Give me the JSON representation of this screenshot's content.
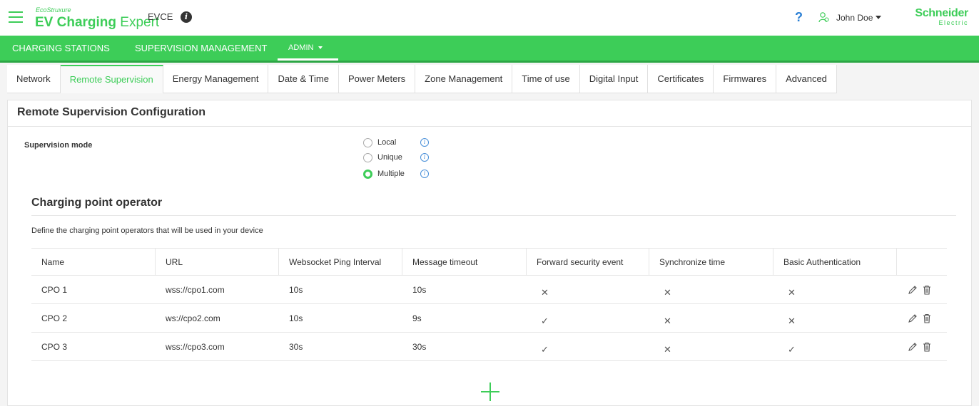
{
  "header": {
    "brand_small": "EcoStruxure",
    "brand_main_bold": "EV Charging",
    "brand_main_light": "Expert",
    "device": "EVCE",
    "info_glyph": "i",
    "help_glyph": "?",
    "user_name": "John Doe",
    "company_line1": "Schneider",
    "company_line2": "Electric",
    "accent_color": "#3dcd58"
  },
  "topnav": [
    {
      "label": "CHARGING STATIONS"
    },
    {
      "label": "SUPERVISION MANAGEMENT"
    },
    {
      "label": "ADMIN"
    }
  ],
  "tabs": [
    {
      "label": "Network"
    },
    {
      "label": "Remote Supervision",
      "active": true
    },
    {
      "label": "Energy Management"
    },
    {
      "label": "Date & Time"
    },
    {
      "label": "Power Meters"
    },
    {
      "label": "Zone Management"
    },
    {
      "label": "Time of use"
    },
    {
      "label": "Digital Input"
    },
    {
      "label": "Certificates"
    },
    {
      "label": "Firmwares"
    },
    {
      "label": "Advanced"
    }
  ],
  "panel": {
    "title": "Remote Supervision Configuration",
    "supervision_label": "Supervision mode",
    "modes": [
      {
        "label": "Local",
        "checked": false
      },
      {
        "label": "Unique",
        "checked": false
      },
      {
        "label": "Multiple",
        "checked": true
      }
    ],
    "info_glyph": "i"
  },
  "cpo": {
    "title": "Charging point operator",
    "description": "Define the charging point operators that will be used in your device",
    "columns": [
      "Name",
      "URL",
      "Websocket Ping Interval",
      "Message timeout",
      "Forward security event",
      "Synchronize time",
      "Basic Authentication"
    ],
    "rows": [
      {
        "name": "CPO 1",
        "url": "wss://cpo1.com",
        "ping": "10s",
        "timeout": "10s",
        "forward": "✕",
        "sync": "✕",
        "auth": "✕"
      },
      {
        "name": "CPO 2",
        "url": "ws://cpo2.com",
        "ping": "10s",
        "timeout": "9s",
        "forward": "✓",
        "sync": "✕",
        "auth": "✕"
      },
      {
        "name": "CPO 3",
        "url": "wss://cpo3.com",
        "ping": "30s",
        "timeout": "30s",
        "forward": "✓",
        "sync": "✕",
        "auth": "✓"
      }
    ]
  }
}
